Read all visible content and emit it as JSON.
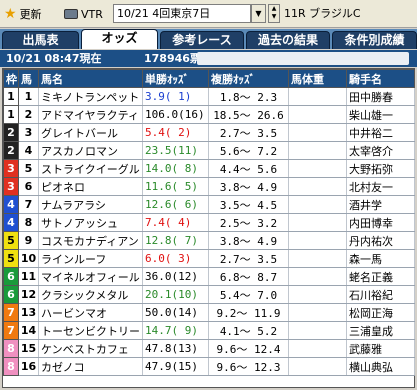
{
  "toolbar": {
    "update_label": "更新",
    "vtr_label": "VTR",
    "race_select_value": "10/21 4回東京7日",
    "race_label": "11R ブラジルC",
    "combo_arrow": "▼",
    "spin_up": "▲",
    "spin_down": "▼"
  },
  "tabs": [
    {
      "label": "出馬表",
      "active": false
    },
    {
      "label": "オッズ",
      "active": true
    },
    {
      "label": "参考レース",
      "active": false
    },
    {
      "label": "過去の結果",
      "active": false
    },
    {
      "label": "条件別成績",
      "active": false
    }
  ],
  "status": {
    "timestamp": "10/21 08:47現在",
    "votes": "178946票"
  },
  "columns": {
    "waku": "枠",
    "num": "馬",
    "name": "馬名",
    "win": "単勝ｵｯｽﾞ",
    "place": "複勝ｵｯｽﾞ",
    "weight": "馬体重",
    "jockey": "騎手名"
  },
  "waku_colors": {
    "1": {
      "bg": "#ffffff",
      "fg": "#000000"
    },
    "2": {
      "bg": "#222222",
      "fg": "#ffffff"
    },
    "3": {
      "bg": "#e03020",
      "fg": "#ffffff"
    },
    "4": {
      "bg": "#2050d0",
      "fg": "#ffffff"
    },
    "5": {
      "bg": "#f0e010",
      "fg": "#000000"
    },
    "6": {
      "bg": "#1a9a3a",
      "fg": "#ffffff"
    },
    "7": {
      "bg": "#f07a10",
      "fg": "#ffffff"
    },
    "8": {
      "bg": "#f090c0",
      "fg": "#ffffff"
    }
  },
  "rows": [
    {
      "waku": "1",
      "num": "1",
      "name": "ミキノトランペット",
      "win": "3.9(  1)",
      "win_color": "blue",
      "place": "1.8～  2.3",
      "jockey": "田中勝春"
    },
    {
      "waku": "1",
      "num": "2",
      "name": "アドマイヤラクティ",
      "win": "106.0(16)",
      "win_color": "black",
      "place": "18.5～ 26.6",
      "jockey": "柴山雄一"
    },
    {
      "waku": "2",
      "num": "3",
      "name": "グレイトバール",
      "win": "5.4(  2)",
      "win_color": "red",
      "place": "2.7～  3.5",
      "jockey": "中井裕二"
    },
    {
      "waku": "2",
      "num": "4",
      "name": "アスカノロマン",
      "win": "23.5(11)",
      "win_color": "green",
      "place": "5.6～  7.2",
      "jockey": "太宰啓介"
    },
    {
      "waku": "3",
      "num": "5",
      "name": "ストライクイーグル",
      "win": "14.0(  8)",
      "win_color": "green",
      "place": "4.4～  5.6",
      "jockey": "大野拓弥"
    },
    {
      "waku": "3",
      "num": "6",
      "name": "ピオネロ",
      "win": "11.6(  5)",
      "win_color": "green",
      "place": "3.8～  4.9",
      "jockey": "北村友一"
    },
    {
      "waku": "4",
      "num": "7",
      "name": "ナムラアラシ",
      "win": "12.6(  6)",
      "win_color": "green",
      "place": "3.5～  4.5",
      "jockey": "酒井学"
    },
    {
      "waku": "4",
      "num": "8",
      "name": "サトノアッシュ",
      "win": "7.4(  4)",
      "win_color": "red",
      "place": "2.5～  3.2",
      "jockey": "内田博幸"
    },
    {
      "waku": "5",
      "num": "9",
      "name": "コスモカナディアン",
      "win": "12.8(  7)",
      "win_color": "green",
      "place": "3.8～  4.9",
      "jockey": "丹内祐次"
    },
    {
      "waku": "5",
      "num": "10",
      "name": "ラインルーフ",
      "win": "6.0(  3)",
      "win_color": "red",
      "place": "2.7～  3.5",
      "jockey": "森一馬"
    },
    {
      "waku": "6",
      "num": "11",
      "name": "マイネルオフィール",
      "win": "36.0(12)",
      "win_color": "black",
      "place": "6.8～  8.7",
      "jockey": "蛯名正義"
    },
    {
      "waku": "6",
      "num": "12",
      "name": "クラシックメタル",
      "win": "20.1(10)",
      "win_color": "green",
      "place": "5.4～  7.0",
      "jockey": "石川裕紀"
    },
    {
      "waku": "7",
      "num": "13",
      "name": "ハービンマオ",
      "win": "50.0(14)",
      "win_color": "black",
      "place": "9.2～ 11.9",
      "jockey": "松岡正海"
    },
    {
      "waku": "7",
      "num": "14",
      "name": "トーセンビクトリー",
      "win": "14.7(  9)",
      "win_color": "green",
      "place": "4.1～  5.2",
      "jockey": "三浦皇成"
    },
    {
      "waku": "8",
      "num": "15",
      "name": "ケンベストカフェ",
      "win": "47.8(13)",
      "win_color": "black",
      "place": "9.6～ 12.4",
      "jockey": "武藤雅"
    },
    {
      "waku": "8",
      "num": "16",
      "name": "カゼノコ",
      "win": "47.9(15)",
      "win_color": "black",
      "place": "9.6～ 12.3",
      "jockey": "横山典弘"
    }
  ]
}
